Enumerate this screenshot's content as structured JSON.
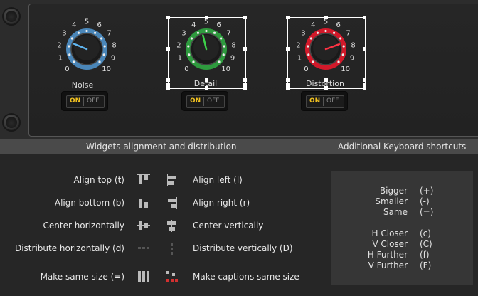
{
  "knobs": [
    {
      "name": "Noise",
      "ring_color": "#4a86b8",
      "pointer_color": "#5fb4ee",
      "ticks": [
        "0",
        "1",
        "2",
        "3",
        "4",
        "5",
        "6",
        "7",
        "8",
        "9",
        "10"
      ],
      "value": 2.5,
      "switch_on": "ON",
      "switch_off": "OFF"
    },
    {
      "name": "Detail",
      "ring_color": "#2e9a3e",
      "pointer_color": "#3dd24a",
      "ticks": [
        "0",
        "1",
        "2",
        "3",
        "4",
        "5",
        "6",
        "7",
        "8",
        "9",
        "10"
      ],
      "value": 4.5,
      "switch_on": "ON",
      "switch_off": "OFF"
    },
    {
      "name": "Distortion",
      "ring_color": "#d2192a",
      "pointer_color": "#ff3344",
      "ticks": [
        "0",
        "1",
        "2",
        "3",
        "4",
        "5",
        "6",
        "7",
        "8",
        "9",
        "10"
      ],
      "value": 7.6,
      "switch_on": "ON",
      "switch_off": "OFF"
    }
  ],
  "header": {
    "align_title": "Widgets alignment and distribution",
    "keys_title": "Additional Keyboard shortcuts"
  },
  "align": {
    "top": "Align top (t)",
    "bottom": "Align bottom (b)",
    "center_h": "Center horizontally",
    "dist_h": "Distribute horizontally (d)",
    "same_size": "Make same size (=)",
    "left": "Align left (l)",
    "right": "Align right (r)",
    "center_v": "Center vertically",
    "dist_v": "Distribute vertically (D)",
    "same_caption": "Make captions same size"
  },
  "shortcuts": {
    "bigger": "Bigger",
    "bigger_key": "(+)",
    "smaller": "Smaller",
    "smaller_key": "(-)",
    "same": "Same",
    "same_key": "(=)",
    "hcloser": "H Closer",
    "hcloser_key": "(c)",
    "vcloser": "V Closer",
    "vcloser_key": "(C)",
    "hfurther": "H Further",
    "hfurther_key": "(f)",
    "vfurther": "V Further",
    "vfurther_key": "(F)"
  }
}
